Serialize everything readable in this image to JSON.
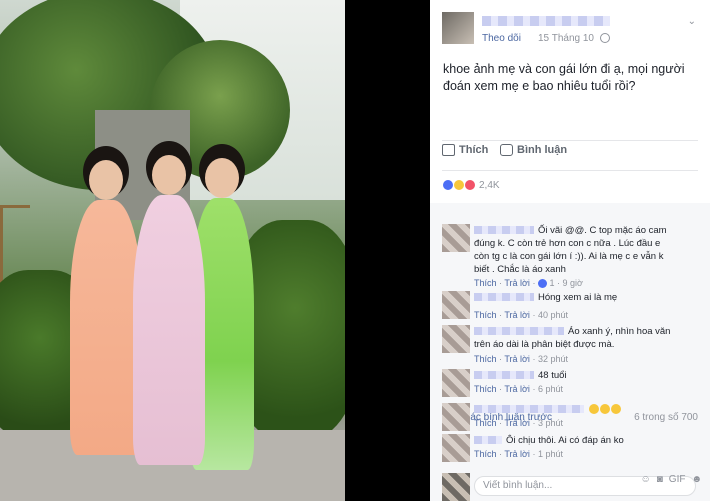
{
  "post": {
    "follow_label": "Theo dõi",
    "date": "15 Tháng 10",
    "caption": "khoe ảnh mẹ và con gái lớn đi ạ, mọi người đoán xem mẹ e bao nhiêu tuổi rồi?",
    "like_label": "Thích",
    "comment_label": "Bình luận",
    "reaction_count": "2,4K",
    "more_comments_label": "Xem các bình luận trước",
    "comment_count_label": "6 trong số 700"
  },
  "comments": [
    {
      "text": "Ối vãi @@. C top mặc áo cam đúng k. C còn trẻ hơn con c nữa . Lúc đầu e còn tg c là con gái lớn í :)). Ai là mẹ c e vẫn k biết . Chắc là áo xanh",
      "like": "Thích",
      "reply": "Trả lời",
      "reactions": "1",
      "time": "9 giờ"
    },
    {
      "text": "Hóng xem ai là mẹ",
      "like": "Thích",
      "reply": "Trả lời",
      "time": "40 phút"
    },
    {
      "text": "Áo xanh ý, nhìn hoa văn trên áo dài là phân biệt được mà.",
      "like": "Thích",
      "reply": "Trả lời",
      "time": "32 phút"
    },
    {
      "text": "48 tuổi",
      "like": "Thích",
      "reply": "Trả lời",
      "time": "6 phút"
    },
    {
      "text": "",
      "like": "Thích",
      "reply": "Trả lời",
      "time": "3 phút"
    },
    {
      "text": "Ôi chịu thôi. Ai có đáp án ko",
      "like": "Thích",
      "reply": "Trả lời",
      "time": "1 phút"
    }
  ],
  "composer": {
    "placeholder": "Viết bình luận...",
    "gif_label": "GIF"
  },
  "colors": {
    "link": "#4b67a1",
    "muted": "#90949c",
    "text": "#1d2129"
  }
}
